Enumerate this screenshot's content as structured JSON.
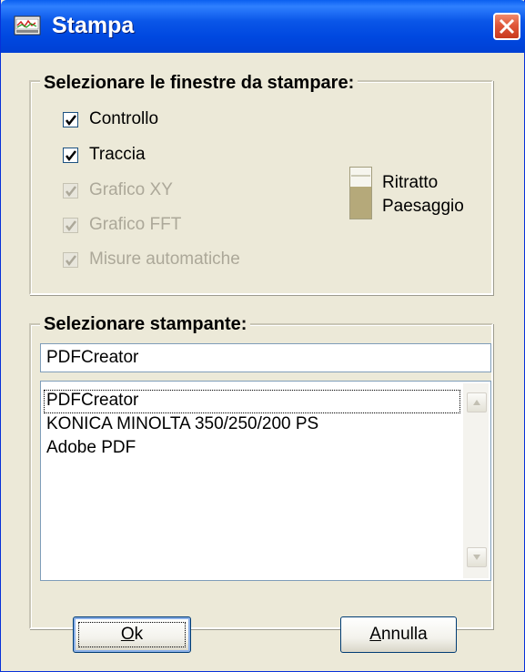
{
  "window": {
    "title": "Stampa",
    "close_icon": "close-icon",
    "app_icon": "app-window-icon"
  },
  "windows_group": {
    "title": "Selezionare le finestre da stampare:",
    "checkboxes": [
      {
        "label": "Controllo",
        "checked": true,
        "enabled": true
      },
      {
        "label": "Traccia",
        "checked": true,
        "enabled": true
      },
      {
        "label": "Grafico XY",
        "checked": true,
        "enabled": false
      },
      {
        "label": "Grafico FFT",
        "checked": true,
        "enabled": false
      },
      {
        "label": "Misure automatiche",
        "checked": true,
        "enabled": false
      }
    ],
    "orientation": {
      "portrait_label": "Ritratto",
      "landscape_label": "Paesaggio",
      "icon": "orientation-icon"
    }
  },
  "printer_group": {
    "title": "Selezionare stampante:",
    "selected_value": "PDFCreator",
    "printers": [
      "PDFCreator",
      "KONICA MINOLTA 350/250/200 PS",
      "Adobe PDF"
    ]
  },
  "buttons": {
    "ok_prefix": "",
    "ok_mnemonic": "O",
    "ok_rest": "k",
    "cancel_mnemonic": "A",
    "cancel_rest": "nnulla"
  },
  "colors": {
    "titlebar": "#0a56e8",
    "dialog_bg": "#ece9d8",
    "close_button": "#e0573a",
    "disabled_text": "#aca899"
  }
}
